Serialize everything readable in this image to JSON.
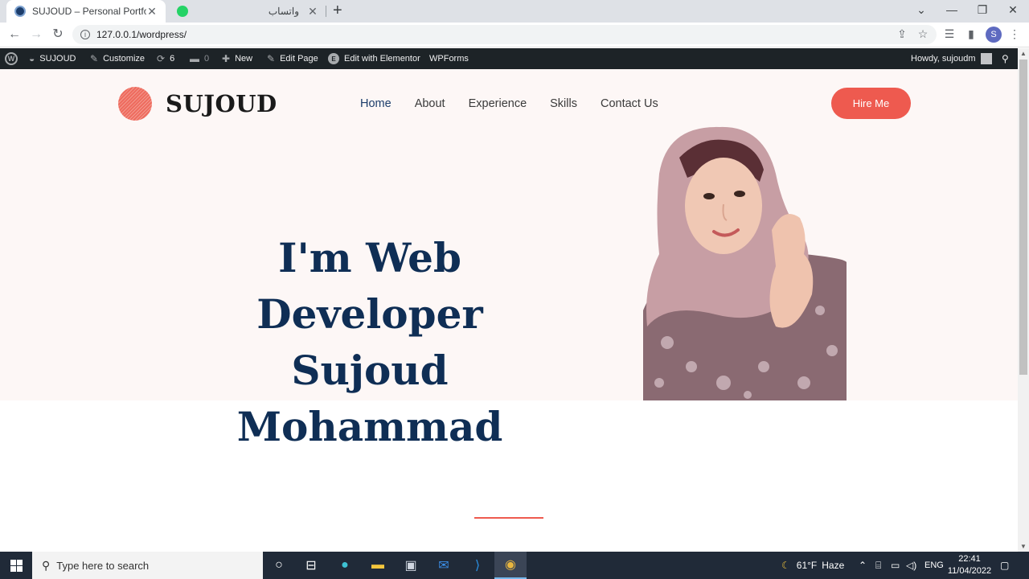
{
  "browser": {
    "tabs": [
      {
        "title": "SUJOUD – Personal Portfolio Web",
        "active": true,
        "favicon": "wordpress-icon",
        "close": "✕"
      },
      {
        "title": "واتساب",
        "active": false,
        "favicon": "whatsapp-icon",
        "close": "✕"
      }
    ],
    "new_tab": "+",
    "window_controls": {
      "dropdown": "⌄",
      "minimize": "—",
      "restore": "❐",
      "close": "✕"
    },
    "url": "127.0.0.1/wordpress/",
    "profile_initial": "S"
  },
  "adminbar": {
    "site_name": "SUJOUD",
    "customize": "Customize",
    "updates_count": "6",
    "comments_count": "0",
    "new": "New",
    "edit_page": "Edit Page",
    "elementor_badge": "E",
    "edit_elementor": "Edit with Elementor",
    "wpforms": "WPForms",
    "howdy": "Howdy, sujoudm"
  },
  "site": {
    "logo_text": "SUJOUD",
    "nav": [
      "Home",
      "About",
      "Experience",
      "Skills",
      "Contact Us"
    ],
    "current_nav": "Home",
    "hire_button": "Hire Me",
    "headline_line1": "I'm Web Developer",
    "headline_line2": "Sujoud Mohammad"
  },
  "taskbar": {
    "search_placeholder": "Type here to search",
    "weather_temp": "61°F",
    "weather_text": "Haze",
    "language": "ENG",
    "time": "22:41",
    "date": "11/04/2022"
  },
  "colors": {
    "accent": "#ee5a4f",
    "headline": "#0f2e55",
    "hero_bg": "#fdf7f6",
    "adminbar_bg": "#1d2327",
    "taskbar_bg": "#202a38"
  }
}
